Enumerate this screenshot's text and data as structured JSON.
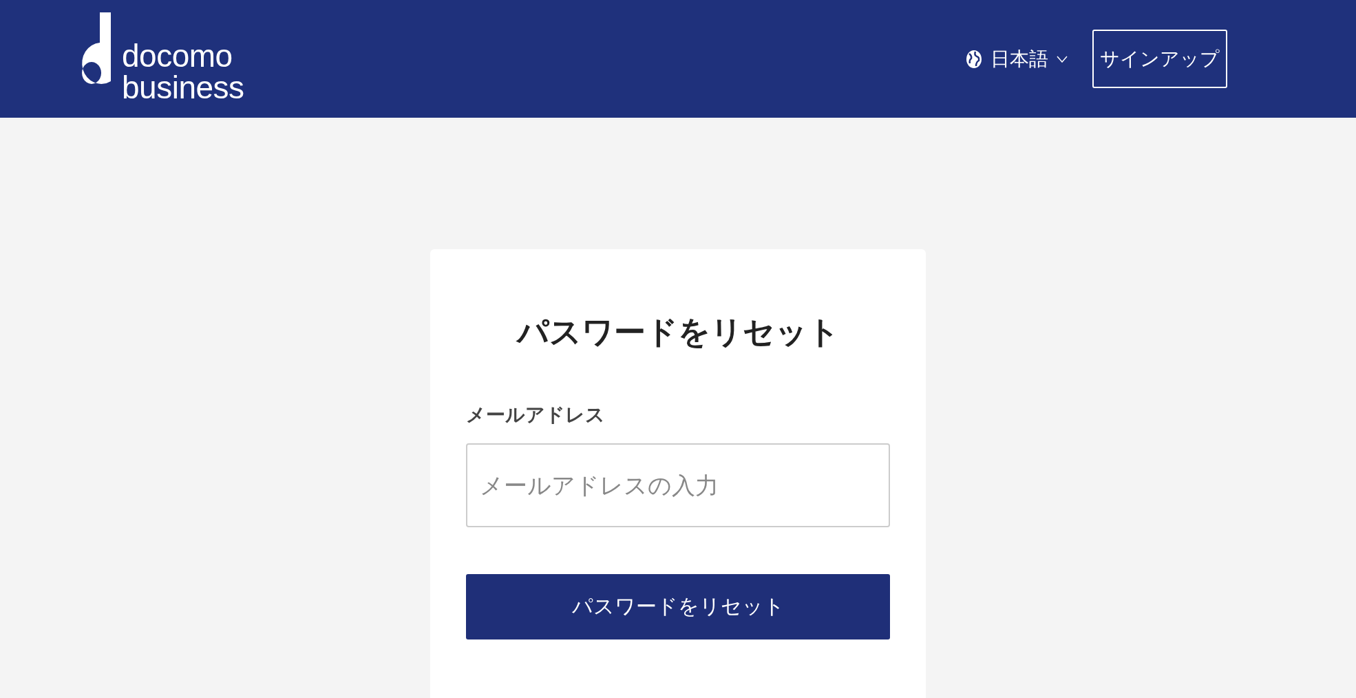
{
  "header": {
    "logo": {
      "line_1": "docomo",
      "line_2": "business"
    },
    "language": "日本語",
    "signup_button": "サインアップ"
  },
  "card": {
    "title": "パスワードをリセット",
    "email_field": {
      "label": "メールアドレス",
      "placeholder": "メールアドレスの入力"
    },
    "submit_button": "パスワードをリセット"
  }
}
